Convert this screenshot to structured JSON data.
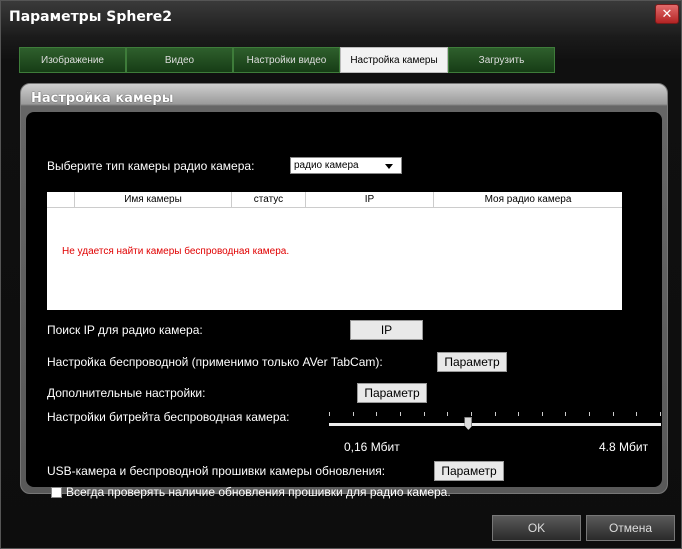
{
  "window": {
    "title": "Параметры Sphere2",
    "close_glyph": "✕"
  },
  "tabs": [
    {
      "label": "Изображение",
      "active": false
    },
    {
      "label": "Видео",
      "active": false
    },
    {
      "label": "Настройки видео",
      "active": false
    },
    {
      "label": "Настройка камеры",
      "active": true
    },
    {
      "label": "Загрузить",
      "active": false
    }
  ],
  "panel": {
    "title": "Настройка камеры",
    "camera_type_label": "Выберите тип камеры радио камера:",
    "camera_type_value": "радио камера",
    "table": {
      "columns": [
        "",
        "Имя камеры",
        "статус",
        "IP",
        "Моя радио камера"
      ],
      "message": "Не удается найти камеры беспроводная камера."
    },
    "ip_search_label": "Поиск IP для радио камера:",
    "ip_button": "IP",
    "wireless_label": "Настройка беспроводной (применимо только AVer TabCam):",
    "wireless_button": "Параметр",
    "advanced_label": "Дополнительные настройки:",
    "advanced_button": "Параметр",
    "bitrate_label": "Настройки битрейта беспроводная камера:",
    "bitrate_min_label": "0,16 Мбит",
    "bitrate_max_label": "4.8 Мбит",
    "bitrate_position": 0.42,
    "firmware_label": "USB-камера и беспроводной прошивки камеры обновления:",
    "firmware_button": "Параметр",
    "always_check_label": "Всегда проверять наличие обновления прошивки для радио камера.",
    "always_check_checked": false
  },
  "footer": {
    "ok": "OK",
    "cancel": "Отмена"
  },
  "icons": {
    "close": "close-icon",
    "dropdown": "chevron-down-icon"
  },
  "colors": {
    "tab_green": "#2e5f2c",
    "error_red": "#e00000"
  }
}
